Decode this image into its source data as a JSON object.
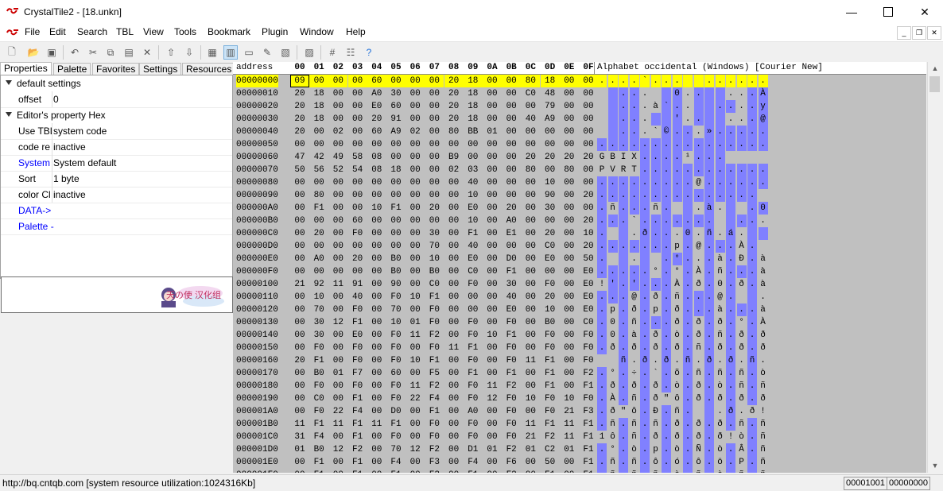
{
  "window": {
    "title": "CrystalTile2 - [18.unkn]"
  },
  "menu": [
    "File",
    "Edit",
    "Search",
    "TBL",
    "View",
    "Tools",
    "Bookmark",
    "Plugin",
    "Window",
    "Help"
  ],
  "tabs": [
    "Properties",
    "Palette",
    "Favorites",
    "Settings",
    "Resources"
  ],
  "props": {
    "cat1": "default settings",
    "offset_name": "offset",
    "offset_val": "0",
    "cat2": "Editor's property Hex",
    "rows": [
      {
        "name": "Use TBL",
        "val": "system code"
      },
      {
        "name": "code re",
        "val": "inactive"
      },
      {
        "name": "System l",
        "val": "System default"
      },
      {
        "name": "Sort",
        "val": "1 byte"
      },
      {
        "name": "color Cl",
        "val": "inactive"
      },
      {
        "name": "DATA->",
        "val": ""
      },
      {
        "name": "Palette -",
        "val": ""
      }
    ]
  },
  "logo_text": "天の使 汉化组",
  "hex": {
    "address_label": "address",
    "columns": [
      "00",
      "01",
      "02",
      "03",
      "04",
      "05",
      "06",
      "07",
      "08",
      "09",
      "0A",
      "0B",
      "0C",
      "0D",
      "0E",
      "0F"
    ],
    "charset_label": "Alphabet occidental (Windows) [Courier New]",
    "rows": [
      {
        "addr": "00000000",
        "bytes": "09 00 00 00 60 00 00 00 20 18 00 00 80 18 00 00",
        "chars": ". . . . ` . . .   . . . . . . ."
      },
      {
        "addr": "00000010",
        "bytes": "20 18 00 00 A0 30 00 00 20 18 00 00 C0 48 00 00",
        "chars": "  . . .   0 . .   . . . À H . ."
      },
      {
        "addr": "00000020",
        "bytes": "20 18 00 00 E0 60 00 00 20 18 00 00 00 79 00 00",
        "chars": "  . . . à ` . .   . . . . y . ."
      },
      {
        "addr": "00000030",
        "bytes": "20 18 00 00 20 91 00 00 20 18 00 00 40 A9 00 00",
        "chars": "  . . .   ' . .   . . . @ © . ."
      },
      {
        "addr": "00000040",
        "bytes": "20 00 02 00 60 A9 02 00 80 BB 01 00 00 00 00 00",
        "chars": "  . . . ` © . . . » . . . . . ."
      },
      {
        "addr": "00000050",
        "bytes": "00 00 00 00 00 00 00 00 00 00 00 00 00 00 00 00",
        "chars": ". . . . . . . . . . . . . . . ."
      },
      {
        "addr": "00000060",
        "bytes": "47 42 49 58 08 00 00 00 B9 00 00 00 20 20 20 20",
        "chars": "G B I X . . . . ¹ . . .        "
      },
      {
        "addr": "00000070",
        "bytes": "50 56 52 54 08 18 00 00 02 03 00 00 80 00 80 00",
        "chars": "P V R T . . . . . . . . . . . ."
      },
      {
        "addr": "00000080",
        "bytes": "00 00 00 00 00 00 00 00 00 40 00 00 00 10 00 00",
        "chars": ". . . . . . . . . @ . . . . . ."
      },
      {
        "addr": "00000090",
        "bytes": "00 80 00 00 00 00 00 00 00 10 00 00 00 90 00 20",
        "chars": ". . . . . . . . . . . . . . .  "
      },
      {
        "addr": "000000A0",
        "bytes": "00 F1 00 00 10 F1 00 20 00 E0 00 20 00 30 00 00",
        "chars": ". ñ . . . ñ .   . à .   . 0 . ."
      },
      {
        "addr": "000000B0",
        "bytes": "00 00 00 60 00 00 00 00 00 10 00 A0 00 00 00 20",
        "chars": ". . . ` . . . . . . .   . . .  "
      },
      {
        "addr": "000000C0",
        "bytes": "00 20 00 F0 00 00 00 30 00 F1 00 E1 00 20 00 10",
        "chars": ".   . ð . . . 0 . ñ . á .   . ."
      },
      {
        "addr": "000000D0",
        "bytes": "00 00 00 00 00 00 00 70 00 40 00 00 00 C0 00 20",
        "chars": ". . . . . . . p . @ . . . À .  "
      },
      {
        "addr": "000000E0",
        "bytes": "00 A0 00 20 00 B0 00 10 00 E0 00 D0 00 E0 00 50",
        "chars": ".   .   . ° . . . à . Ð . à . P"
      },
      {
        "addr": "000000F0",
        "bytes": "00 00 00 00 00 B0 00 B0 00 C0 00 F1 00 00 00 E0",
        "chars": ". . . . . ° . ° . À . ñ . . . à"
      },
      {
        "addr": "00000100",
        "bytes": "21 92 11 91 00 90 00 C0 00 F0 00 30 00 F0 00 E0",
        "chars": "! ' . ' . . . À . ð . 0 . ð . à"
      },
      {
        "addr": "00000110",
        "bytes": "00 10 00 40 00 F0 10 F1 00 00 00 40 00 20 00 E0",
        "chars": ". . . @ . ð . ñ . . . @ .   . à"
      },
      {
        "addr": "00000120",
        "bytes": "00 70 00 F0 00 70 00 F0 00 00 00 E0 00 10 00 E0",
        "chars": ". p . ð . p . ð . . . à . . . à"
      },
      {
        "addr": "00000130",
        "bytes": "00 30 12 F1 00 10 01 F0 00 F0 00 F0 00 B0 00 C0",
        "chars": ". 0 . ñ . . . ð . ð . ð . ° . À"
      },
      {
        "addr": "00000140",
        "bytes": "00 30 00 E0 00 F0 11 F2 00 F0 10 F1 00 F0 00 F0",
        "chars": ". 0 . à . ð . ò . ð . ñ . ð . ð"
      },
      {
        "addr": "00000150",
        "bytes": "00 F0 00 F0 00 F0 00 F0 11 F1 00 F0 00 F0 00 F0",
        "chars": ". ð . ð . ð . ð . ñ . ð . ð . ð"
      },
      {
        "addr": "00000160",
        "bytes": "20 F1 00 F0 00 F0 10 F1 00 F0 00 F0 11 F1 00 F0",
        "chars": "  ñ . ð . ð . ñ . ð . ð . ñ . ð"
      },
      {
        "addr": "00000170",
        "bytes": "00 B0 01 F7 00 60 00 F5 00 F1 00 F1 00 F1 00 F2",
        "chars": ". ° . ÷ . ` . õ . ñ . ñ . ñ . ò"
      },
      {
        "addr": "00000180",
        "bytes": "00 F0 00 F0 00 F0 11 F2 00 F0 11 F2 00 F1 00 F1",
        "chars": ". ð . ð . ð . ò . ð . ò . ñ . ñ"
      },
      {
        "addr": "00000190",
        "bytes": "00 C0 00 F1 00 F0 22 F4 00 F0 12 F0 10 F0 10 F0",
        "chars": ". À . ñ . ð \" ô . ð . ð . ð . ð"
      },
      {
        "addr": "000001A0",
        "bytes": "00 F0 22 F4 00 D0 00 F1 00 A0 00 F0 00 F0 21 F3",
        "chars": ". ð \" ô . Ð . ñ .   . ð . ð ! ó"
      },
      {
        "addr": "000001B0",
        "bytes": "11 F1 11 F1 11 F1 00 F0 00 F0 00 F0 11 F1 11 F1",
        "chars": ". ñ . ñ . ñ . ð . ð . ð . ñ . ñ"
      },
      {
        "addr": "000001C0",
        "bytes": "31 F4 00 F1 00 F0 00 F0 00 F0 00 F0 21 F2 11 F1",
        "chars": "1 ô . ñ . ð . ð . ð . ð ! ò . ñ"
      },
      {
        "addr": "000001D0",
        "bytes": "01 B0 12 F2 00 70 12 F2 00 D1 01 F2 01 C2 01 F1",
        "chars": ". ° . ò . p . ò . Ñ . ò . Â . ñ"
      },
      {
        "addr": "000001E0",
        "bytes": "00 F1 00 F1 00 F4 00 F3 00 F4 00 F6 00 50 00 F1",
        "chars": ". ñ . ñ . ô . ó . ô . ö . P . ñ"
      },
      {
        "addr": "000001F0",
        "bytes": "00 F1 00 F1 00 F1 00 F2 00 F1 00 F2 00 F1 00 F1",
        "chars": ". ñ . ñ . ñ . ò . ñ . ò . ñ . ñ"
      }
    ]
  },
  "status": {
    "left": "http://bq.cntqb.com [system resource utilization:1024316Kb]",
    "box1": "00001001",
    "box2": "00000000"
  },
  "colors": {
    "highlight": "#ffff00",
    "nonprint": "#8080ff",
    "hexbg": "#c0c0c0"
  }
}
